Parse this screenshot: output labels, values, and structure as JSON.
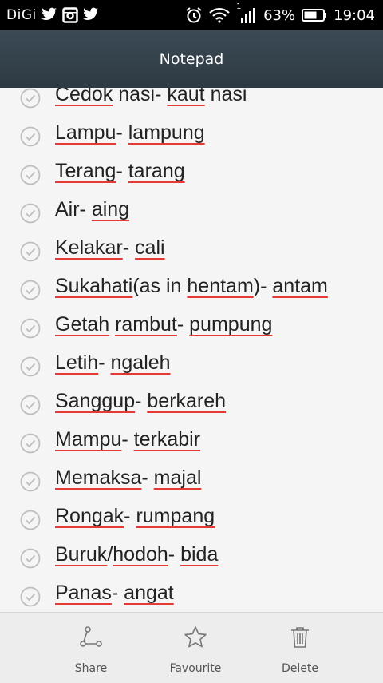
{
  "status_bar": {
    "carrier": "DiGi",
    "battery": "63%",
    "time": "19:04",
    "signal_badge": "1"
  },
  "app_bar": {
    "title": "Notepad"
  },
  "items": [
    {
      "parts": [
        {
          "t": "Cedok",
          "u": true
        },
        {
          "t": " nasi- ",
          "u": false
        },
        {
          "t": "kaut",
          "u": true
        },
        {
          "t": " nasi",
          "u": false
        }
      ]
    },
    {
      "parts": [
        {
          "t": "Lampu",
          "u": true
        },
        {
          "t": "- ",
          "u": false
        },
        {
          "t": "lampung",
          "u": true
        }
      ]
    },
    {
      "parts": [
        {
          "t": "Terang",
          "u": true
        },
        {
          "t": "- ",
          "u": false
        },
        {
          "t": "tarang",
          "u": true
        }
      ]
    },
    {
      "parts": [
        {
          "t": "Air- ",
          "u": false
        },
        {
          "t": "aing",
          "u": true
        }
      ]
    },
    {
      "parts": [
        {
          "t": "Kelakar",
          "u": true
        },
        {
          "t": "- ",
          "u": false
        },
        {
          "t": "cali",
          "u": true
        }
      ]
    },
    {
      "parts": [
        {
          "t": "Sukahati",
          "u": true
        },
        {
          "t": "(as in ",
          "u": false
        },
        {
          "t": "hentam",
          "u": true
        },
        {
          "t": ")- ",
          "u": false
        },
        {
          "t": "antam",
          "u": true
        }
      ]
    },
    {
      "parts": [
        {
          "t": "Getah",
          "u": true
        },
        {
          "t": " ",
          "u": false
        },
        {
          "t": "rambut",
          "u": true
        },
        {
          "t": "- ",
          "u": false
        },
        {
          "t": "pumpung",
          "u": true
        }
      ]
    },
    {
      "parts": [
        {
          "t": "Letih",
          "u": true
        },
        {
          "t": "- ",
          "u": false
        },
        {
          "t": "ngaleh",
          "u": true
        }
      ]
    },
    {
      "parts": [
        {
          "t": "Sanggup",
          "u": true
        },
        {
          "t": "- ",
          "u": false
        },
        {
          "t": "berkareh",
          "u": true
        }
      ]
    },
    {
      "parts": [
        {
          "t": "Mampu",
          "u": true
        },
        {
          "t": "- ",
          "u": false
        },
        {
          "t": "terkabir",
          "u": true
        }
      ]
    },
    {
      "parts": [
        {
          "t": "Memaksa",
          "u": true
        },
        {
          "t": "- ",
          "u": false
        },
        {
          "t": "majal",
          "u": true
        }
      ]
    },
    {
      "parts": [
        {
          "t": "Rongak",
          "u": true
        },
        {
          "t": "- ",
          "u": false
        },
        {
          "t": "rumpang",
          "u": true
        }
      ]
    },
    {
      "parts": [
        {
          "t": "Buruk",
          "u": true
        },
        {
          "t": "/",
          "u": false
        },
        {
          "t": "hodoh",
          "u": true
        },
        {
          "t": "- ",
          "u": false
        },
        {
          "t": "bida",
          "u": true
        }
      ]
    },
    {
      "parts": [
        {
          "t": "Panas",
          "u": true
        },
        {
          "t": "- ",
          "u": false
        },
        {
          "t": "angat",
          "u": true
        }
      ]
    }
  ],
  "bottom_bar": {
    "share_label": "Share",
    "favourite_label": "Favourite",
    "delete_label": "Delete"
  },
  "colors": {
    "app_bar": "#35434d",
    "spellcheck_underline": "#e53935",
    "check_icon": "#bdbdbd"
  }
}
